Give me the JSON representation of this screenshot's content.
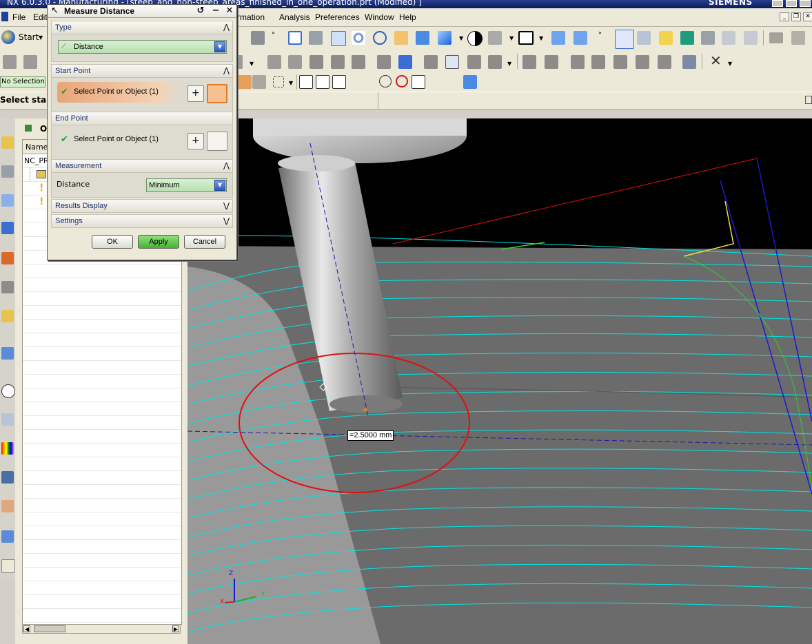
{
  "window": {
    "title": "NX 6.0.3.0 - Manufacturing - [steep_and_non-steep_areas_finished_in_one_operation.prt (Modified) ]",
    "brand": "SIEMENS"
  },
  "menubar": {
    "items": [
      {
        "label": "File",
        "accel": "F"
      },
      {
        "label": "Edit",
        "accel": "E"
      },
      {
        "label": "Information",
        "accel": "I"
      },
      {
        "label": "Analysis",
        "accel": "A"
      },
      {
        "label": "Preferences",
        "accel": "P"
      },
      {
        "label": "Window",
        "accel": "W"
      },
      {
        "label": "Help",
        "accel": "H"
      }
    ],
    "start_label": "Start"
  },
  "selection_bar": {
    "filter_value": "No Selection Filter"
  },
  "cue_line": {
    "prompt": "Select start point"
  },
  "navigator": {
    "column_name": "Name",
    "header_letter": "O",
    "root_item": "NC_PROGRAM"
  },
  "dialog": {
    "title": "Measure Distance",
    "groups": {
      "type": {
        "label": "Type",
        "value": "Distance"
      },
      "start_point": {
        "label": "Start Point",
        "selection": "Select Point or Object (1)"
      },
      "end_point": {
        "label": "End Point",
        "selection": "Select Point or Object (1)"
      },
      "measurement": {
        "label": "Measurement",
        "field_label": "Distance",
        "value": "Minimum"
      },
      "results_display": {
        "label": "Results Display"
      },
      "settings": {
        "label": "Settings"
      }
    },
    "buttons": {
      "ok": "OK",
      "apply": "Apply",
      "cancel": "Cancel"
    }
  },
  "graphics": {
    "measurement_readout": "=2.5000 mm",
    "triad": {
      "z": "Z",
      "y": "Y",
      "x": "X"
    }
  },
  "colors": {
    "start_point_highlight": "#e9a577",
    "apply_button": "#5fc24a",
    "combo_green": "#b7e0af",
    "circle": "#e01010",
    "toolpath": "#00e5e5",
    "background": "#000000"
  }
}
